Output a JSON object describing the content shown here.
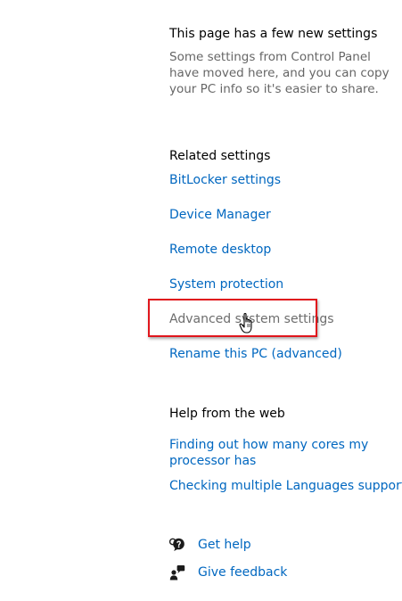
{
  "new_settings": {
    "title": "This page has a few new settings",
    "description_lines": [
      "Some settings from Control Panel",
      "have moved here, and you can copy",
      "your PC info so it's easier to share."
    ]
  },
  "related": {
    "title": "Related settings",
    "links": {
      "bitlocker": "BitLocker settings",
      "device_manager": "Device Manager",
      "remote_desktop": "Remote desktop",
      "system_protection": "System protection",
      "advanced_system": "Advanced system settings",
      "rename_pc": "Rename this PC (advanced)"
    }
  },
  "web_help": {
    "title": "Help from the web",
    "cores_lines": [
      "Finding out how many cores my",
      "processor has"
    ],
    "languages": "Checking multiple Languages support"
  },
  "support": {
    "get_help": "Get help",
    "give_feedback": "Give feedback",
    "get_help_icon": "get-help-icon",
    "feedback_icon": "feedback-icon"
  },
  "colors": {
    "link": "#0067c0",
    "highlight": "#e0161c",
    "muted_text": "#666666"
  }
}
